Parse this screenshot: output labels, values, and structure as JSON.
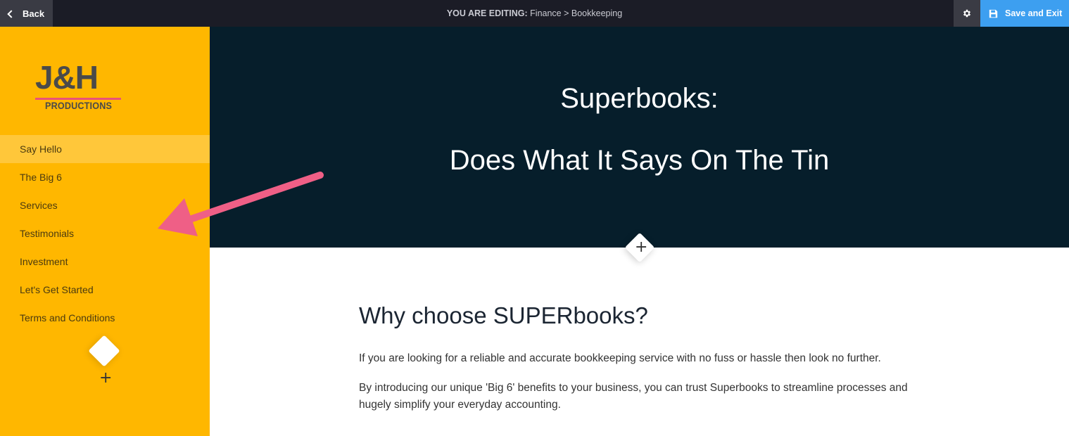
{
  "topbar": {
    "back_label": "Back",
    "editing_prefix": "YOU ARE EDITING:",
    "editing_path": "Finance > Bookkeeping",
    "save_label": "Save and Exit",
    "settings_icon": "gear-icon",
    "save_icon": "floppy-disk-icon"
  },
  "sidebar": {
    "logo_main": "J&H",
    "logo_sub": "PRODUCTIONS",
    "items": [
      {
        "label": "Say Hello"
      },
      {
        "label": "The Big 6"
      },
      {
        "label": "Services"
      },
      {
        "label": "Testimonials"
      },
      {
        "label": "Investment"
      },
      {
        "label": "Let's Get Started"
      },
      {
        "label": "Terms and Conditions"
      }
    ],
    "active_index": 0
  },
  "hero": {
    "title": "Superbooks:",
    "subtitle": "Does What It Says On The Tin"
  },
  "content": {
    "heading": "Why choose SUPERbooks?",
    "paragraphs": [
      "If you are looking for a reliable and accurate bookkeeping service with no fuss or hassle then look no further.",
      "By introducing our unique 'Big 6' benefits to your business, you can trust Superbooks to streamline processes and hugely simplify your everyday accounting."
    ]
  },
  "colors": {
    "sidebar_bg": "#ffb700",
    "hero_bg": "#061e2b",
    "save_button": "#3d9ff0",
    "annotation_arrow": "#ef5f86"
  }
}
